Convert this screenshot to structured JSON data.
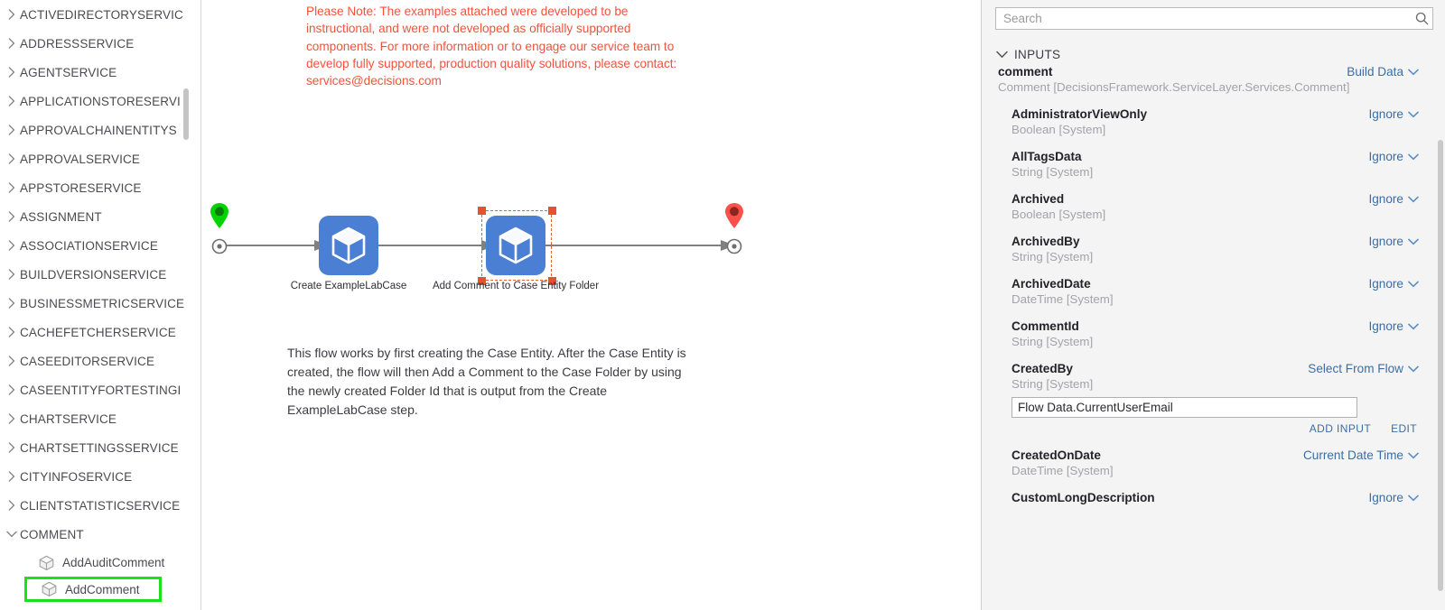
{
  "sidebar": {
    "nodes": [
      {
        "label": "ACTIVEDIRECTORYSERVIC",
        "expanded": false
      },
      {
        "label": "ADDRESSSERVICE",
        "expanded": false
      },
      {
        "label": "AGENTSERVICE",
        "expanded": false
      },
      {
        "label": "APPLICATIONSTORESERVI",
        "expanded": false
      },
      {
        "label": "APPROVALCHAINENTITYS",
        "expanded": false
      },
      {
        "label": "APPROVALSERVICE",
        "expanded": false
      },
      {
        "label": "APPSTORESERVICE",
        "expanded": false
      },
      {
        "label": "ASSIGNMENT",
        "expanded": false
      },
      {
        "label": "ASSOCIATIONSERVICE",
        "expanded": false
      },
      {
        "label": "BUILDVERSIONSERVICE",
        "expanded": false
      },
      {
        "label": "BUSINESSMETRICSERVICE",
        "expanded": false
      },
      {
        "label": "CACHEFETCHERSERVICE",
        "expanded": false
      },
      {
        "label": "CASEEDITORSERVICE",
        "expanded": false
      },
      {
        "label": "CASEENTITYFORTESTINGI",
        "expanded": false
      },
      {
        "label": "CHARTSERVICE",
        "expanded": false
      },
      {
        "label": "CHARTSETTINGSSERVICE",
        "expanded": false
      },
      {
        "label": "CITYINFOSERVICE",
        "expanded": false
      },
      {
        "label": "CLIENTSTATISTICSERVICE",
        "expanded": false
      },
      {
        "label": "COMMENT",
        "expanded": true
      }
    ],
    "leaves": [
      {
        "label": "AddAuditComment",
        "selected": false
      },
      {
        "label": "AddComment",
        "selected": true
      }
    ]
  },
  "canvas": {
    "note": "Please Note: The examples attached were developed to be instructional, and were not developed as officially supported components.  For more information or to engage our service team to develop fully supported, production quality solutions, please contact: services@decisions.com",
    "description": "This flow works by first creating the Case Entity. After the Case Entity is created, the flow will then Add a Comment to the Case Folder by using the newly created Folder Id that is output from the Create ExampleLabCase step.",
    "steps": [
      {
        "label": "Create ExampleLabCase",
        "selected": false
      },
      {
        "label": "Add Comment to Case Entity Folder",
        "selected": true
      }
    ],
    "start_marker": "start-pin",
    "end_marker": "end-pin",
    "colors": {
      "start_pin": "#00d400",
      "end_pin": "#f9524a",
      "step_fill": "#4a7fd4",
      "selection": "#e8622a",
      "note_text": "#f4523b",
      "connector": "#808080"
    }
  },
  "panel": {
    "search": {
      "value": "",
      "placeholder": "Search"
    },
    "section": {
      "title": "INPUTS",
      "expanded": true
    },
    "rows": [
      {
        "name": "comment",
        "type": "Comment [DecisionsFramework.ServiceLayer.Services.Comment]",
        "value": "Build Data",
        "level": 0
      },
      {
        "name": "AdministratorViewOnly",
        "type": "Boolean [System]",
        "value": "Ignore",
        "level": 1
      },
      {
        "name": "AllTagsData",
        "type": "String [System]",
        "value": "Ignore",
        "level": 1
      },
      {
        "name": "Archived",
        "type": "Boolean [System]",
        "value": "Ignore",
        "level": 1
      },
      {
        "name": "ArchivedBy",
        "type": "String [System]",
        "value": "Ignore",
        "level": 1
      },
      {
        "name": "ArchivedDate",
        "type": "DateTime [System]",
        "value": "Ignore",
        "level": 1
      },
      {
        "name": "CommentId",
        "type": "String [System]",
        "value": "Ignore",
        "level": 1
      },
      {
        "name": "CreatedBy",
        "type": "String [System]",
        "value": "Select From Flow",
        "level": 1,
        "input_value": "Flow Data.CurrentUserEmail",
        "actions": [
          "ADD INPUT",
          "EDIT"
        ]
      },
      {
        "name": "CreatedOnDate",
        "type": "DateTime [System]",
        "value": "Current Date Time",
        "level": 1
      },
      {
        "name": "CustomLongDescription",
        "type": "",
        "value": "Ignore",
        "level": 1
      }
    ],
    "add_input_label": "ADD INPUT",
    "edit_label": "EDIT"
  }
}
